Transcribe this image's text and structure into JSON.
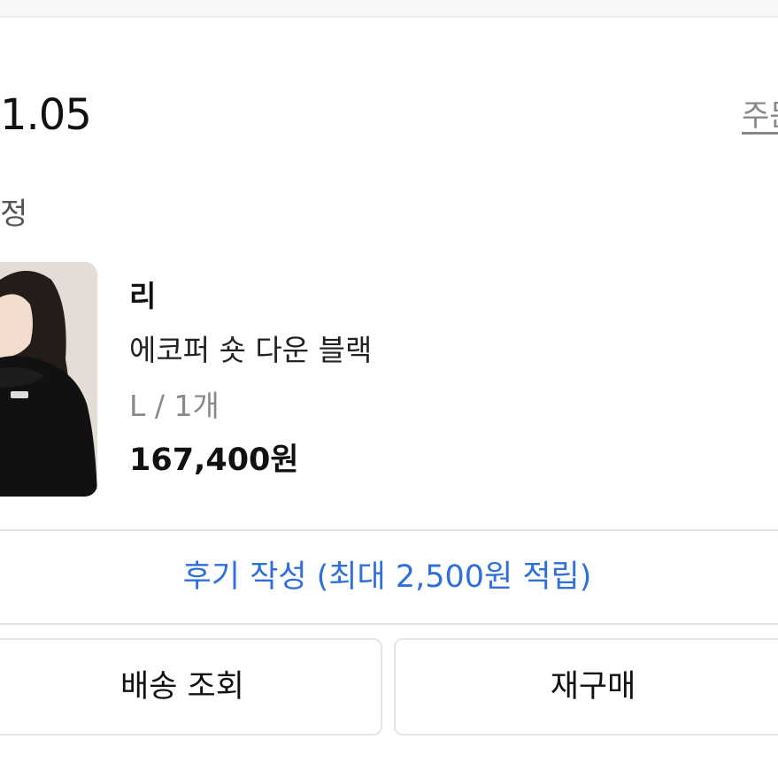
{
  "order": {
    "date": "1.05",
    "detail_link": "주문"
  },
  "status": {
    "label": "정"
  },
  "product": {
    "image": "product photo of woman wearing black fleece down jacket",
    "brand": "리",
    "name": "에코퍼 숏 다운 블랙",
    "option": "L / 1개",
    "price": "167,400원"
  },
  "actions": {
    "review_label": "후기 작성 (최대 2,500원 적립)",
    "track_label": "배송 조회",
    "rebuy_label": "재구매"
  },
  "colors": {
    "accent": "#2e6fdc",
    "border": "#e4e4e4",
    "muted_text": "#8a8a8a"
  }
}
